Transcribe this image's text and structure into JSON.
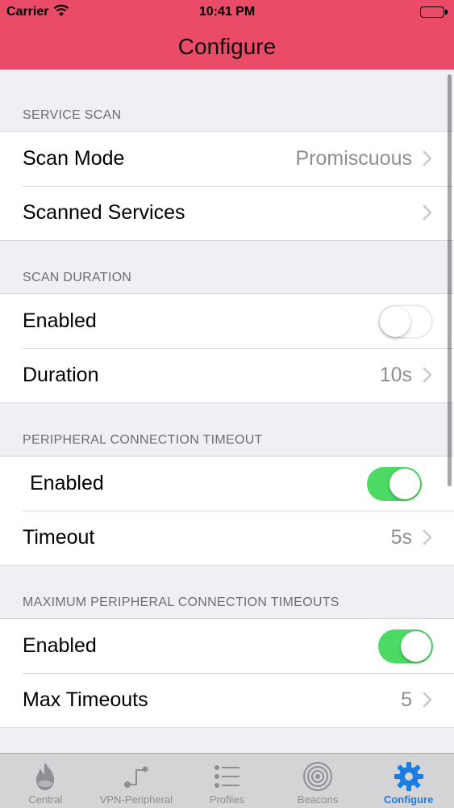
{
  "status_bar": {
    "carrier": "Carrier",
    "time": "10:41 PM",
    "icons": [
      "wifi-icon",
      "battery-icon"
    ]
  },
  "nav": {
    "title": "Configure"
  },
  "sections": [
    {
      "header": "SERVICE SCAN",
      "rows": [
        {
          "label": "Scan Mode",
          "value": "Promiscuous",
          "accessory": "chevron"
        },
        {
          "label": "Scanned Services",
          "value": "",
          "accessory": "chevron"
        }
      ]
    },
    {
      "header": "SCAN DURATION",
      "rows": [
        {
          "label": "Enabled",
          "toggle": false
        },
        {
          "label": "Duration",
          "value": "10s",
          "accessory": "chevron"
        }
      ]
    },
    {
      "header": "PERIPHERAL CONNECTION TIMEOUT",
      "rows": [
        {
          "label": "Enabled",
          "toggle": true
        },
        {
          "label": "Timeout",
          "value": "5s",
          "accessory": "chevron"
        }
      ]
    },
    {
      "header": "MAXIMUM PERIPHERAL CONNECTION TIMEOUTS",
      "rows": [
        {
          "label": "Enabled",
          "toggle": true
        },
        {
          "label": "Max Timeouts",
          "value": "5",
          "accessory": "chevron"
        }
      ]
    }
  ],
  "tabs": [
    {
      "label": "Central",
      "icon": "flame-icon",
      "active": false
    },
    {
      "label": "VPN-Peripheral",
      "icon": "peripheral-icon",
      "active": false
    },
    {
      "label": "Profiles",
      "icon": "list-icon",
      "active": false
    },
    {
      "label": "Beacons",
      "icon": "beacon-icon",
      "active": false
    },
    {
      "label": "Configure",
      "icon": "gear-icon",
      "active": true
    }
  ],
  "colors": {
    "header_bg": "#ea4c67",
    "toggle_on": "#4cd964",
    "tab_active": "#1a7de0",
    "tab_inactive": "#8e8e93"
  }
}
